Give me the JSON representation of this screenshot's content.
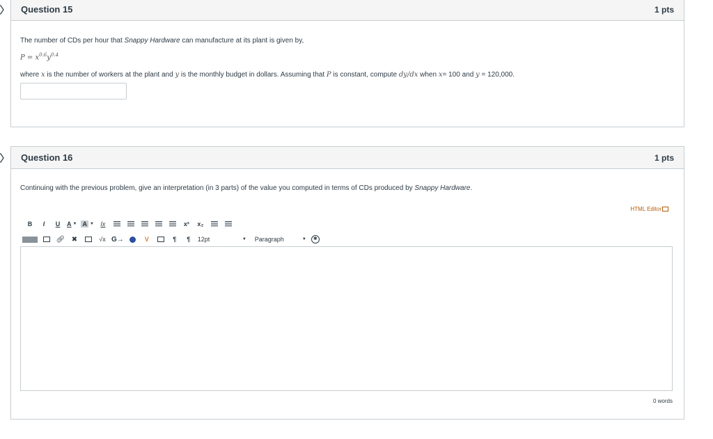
{
  "q15": {
    "title": "Question 15",
    "pts": "1 pts",
    "line1_a": "The number of CDs per hour that ",
    "line1_brand": "Snappy Hardware",
    "line1_b": " can manufacture at its plant is given by,",
    "formula_base1": "P = x",
    "formula_exp1": "0.6",
    "formula_base2": "y",
    "formula_exp2": "0.4",
    "line3_where": "where ",
    "line3_x": "x",
    "line3_a": " is the number of workers at the plant and ",
    "line3_y": "y",
    "line3_b": " is the monthly budget in dollars. Assuming that ",
    "line3_P": "P",
    "line3_c": " is constant, compute ",
    "line3_deriv": "dy/dx",
    "line3_d": " when ",
    "line3_x2": "x",
    "line3_e": "= 100 and ",
    "line3_y2": "y",
    "line3_f": " = 120,000.",
    "answer_value": ""
  },
  "q16": {
    "title": "Question 16",
    "pts": "1 pts",
    "text_a": "Continuing with the previous problem, give an interpretation (in 3 parts) of the value you computed in terms of CDs produced by ",
    "text_brand": "Snappy Hardware",
    "text_b": ".",
    "html_editor": "HTML Editor",
    "font_size": "12pt",
    "block_format": "Paragraph",
    "word_count": "0 words"
  },
  "toolbar": {
    "bold": "B",
    "italic": "I",
    "underline": "U",
    "font_color": "A",
    "bg_color": "A",
    "clear_format": "Ix",
    "superscript": "x²",
    "subscript": "x₂",
    "sqrt": "√x",
    "insert_table": "⊞",
    "ltr": "¶",
    "rtl": "¶"
  },
  "icons": [
    "flag-icon",
    "link-icon",
    "unlink-icon",
    "image-icon",
    "media-icon",
    "lti-icon",
    "accessibility-icon"
  ]
}
